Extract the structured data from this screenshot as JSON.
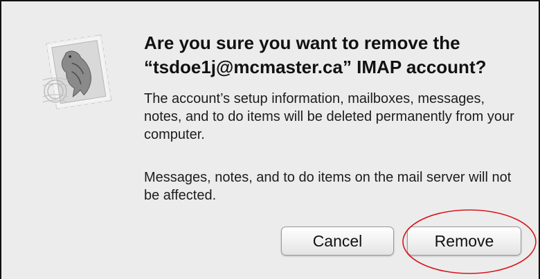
{
  "dialog": {
    "title": "Are you sure you want to remove the “tsdoe1j@mcmaster.ca” IMAP account?",
    "message_1": "The account’s setup information, mailboxes, messages, notes, and to do items will be deleted permanently from your computer.",
    "message_2": "Messages, notes, and to do items on the mail server will not be affected.",
    "icon": "mail-stamp-icon",
    "buttons": {
      "cancel_label": "Cancel",
      "remove_label": "Remove"
    },
    "highlight_color": "#d9141b"
  }
}
